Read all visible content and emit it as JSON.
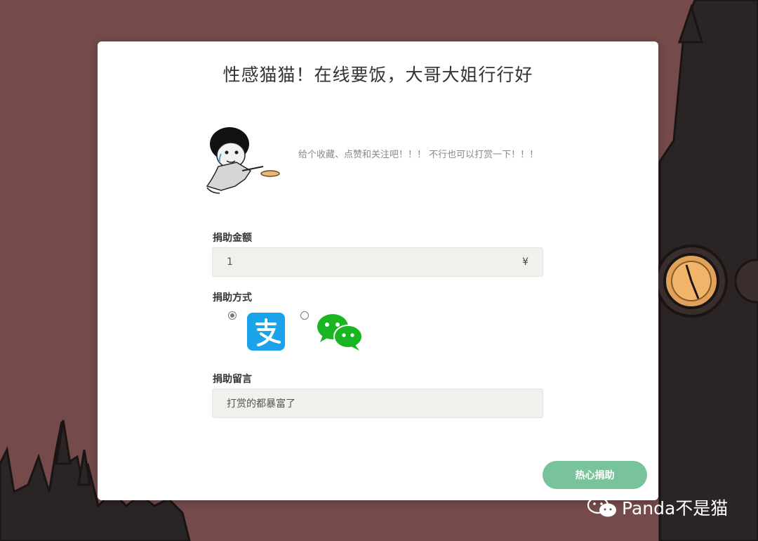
{
  "modal": {
    "title": "性感猫猫！在线要饭，大哥大姐行行好",
    "plea_text": "给个收藏、点赞和关注吧！！！ 不行也可以打赏一下！！！"
  },
  "form": {
    "amount": {
      "label": "捐助金额",
      "value": "1",
      "suffix": "¥"
    },
    "method": {
      "label": "捐助方式",
      "options": [
        {
          "name": "alipay",
          "icon": "alipay-icon",
          "selected": true,
          "color": "#1aa3ea"
        },
        {
          "name": "wechat",
          "icon": "wechat-pay-icon",
          "selected": false,
          "color": "#1ab622"
        }
      ]
    },
    "message": {
      "label": "捐助留言",
      "value": "打赏的都暴富了"
    },
    "submit_label": "热心捐助"
  },
  "watermark": {
    "icon": "wechat-icon",
    "text": "Panda不是猫"
  },
  "colors": {
    "background": "#744a4a",
    "button": "#79c39a",
    "field_bg": "#f1f0ec",
    "alipay": "#1aa3ea",
    "wechat": "#1ab622"
  }
}
